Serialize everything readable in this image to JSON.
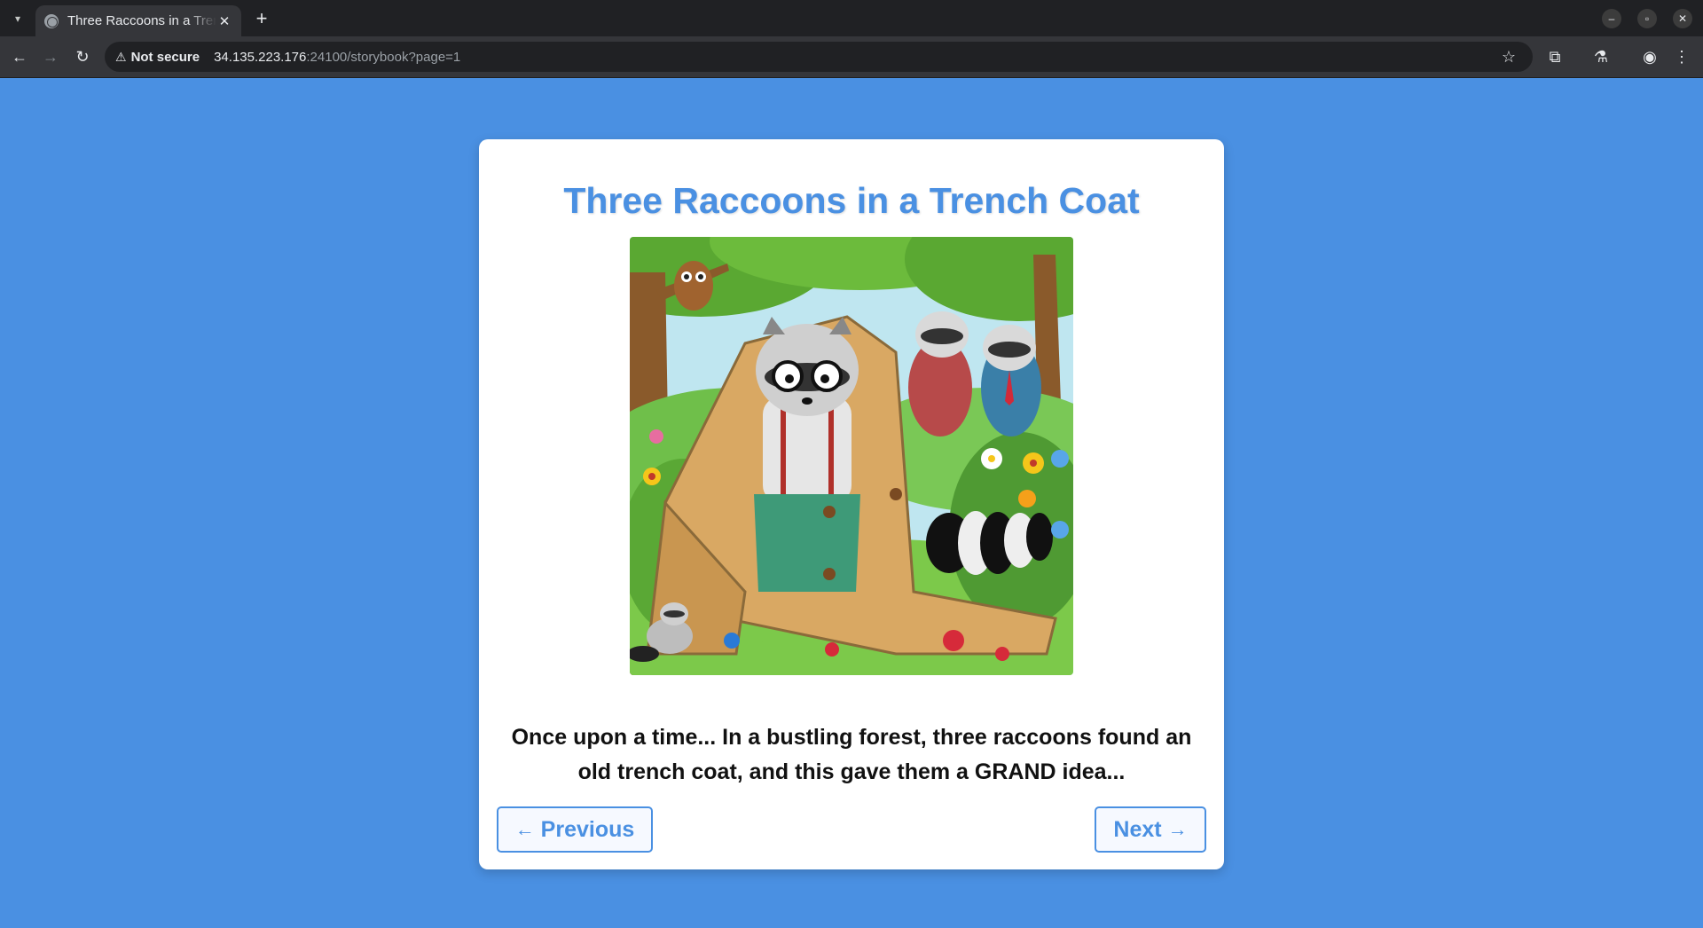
{
  "browser": {
    "tab_title": "Three Raccoons in a Trench Coat",
    "tab_close": "✕",
    "new_tab": "+",
    "security_label": "Not secure",
    "url_host": "34.135.223.176",
    "url_rest": ":24100/storybook?page=1"
  },
  "story": {
    "title": "Three Raccoons in a Trench Coat",
    "text": "Once upon a time... In a bustling forest, three raccoons found an old trench coat, and this gave them a GRAND idea...",
    "prev_arrow": "←",
    "prev_label": "Previous",
    "next_label": "Next",
    "next_arrow": "→"
  },
  "colors": {
    "page_background": "#4a90e2",
    "accent": "#4a90e2",
    "card": "#ffffff"
  }
}
